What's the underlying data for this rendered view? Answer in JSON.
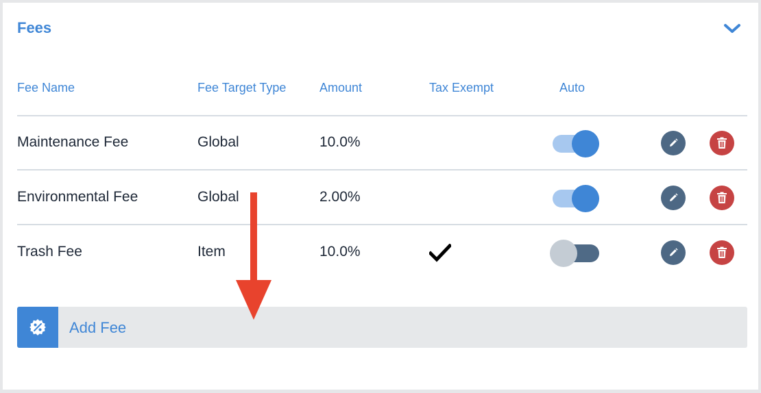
{
  "section": {
    "title": "Fees",
    "collapse_icon": "chevron-down-icon"
  },
  "table": {
    "headers": {
      "fee_name": "Fee Name",
      "fee_target_type": "Fee Target Type",
      "amount": "Amount",
      "tax_exempt": "Tax Exempt",
      "auto": "Auto"
    },
    "rows": [
      {
        "name": "Maintenance Fee",
        "target_type": "Global",
        "amount": "10.0%",
        "tax_exempt": false,
        "auto": true
      },
      {
        "name": "Environmental Fee",
        "target_type": "Global",
        "amount": "2.00%",
        "tax_exempt": false,
        "auto": true
      },
      {
        "name": "Trash Fee",
        "target_type": "Item",
        "amount": "10.0%",
        "tax_exempt": true,
        "auto": false
      }
    ],
    "row_icons": {
      "edit": "pencil-icon",
      "delete": "trash-icon",
      "tax_exempt": "checkmark-icon"
    }
  },
  "add_fee": {
    "label": "Add Fee",
    "icon": "percent-badge-icon"
  },
  "annotation": {
    "icon": "red-down-arrow-icon",
    "color": "#e8432d"
  },
  "colors": {
    "accent": "#3f86d6",
    "edit": "#4d6884",
    "delete": "#c64343",
    "text": "#1d2736"
  }
}
